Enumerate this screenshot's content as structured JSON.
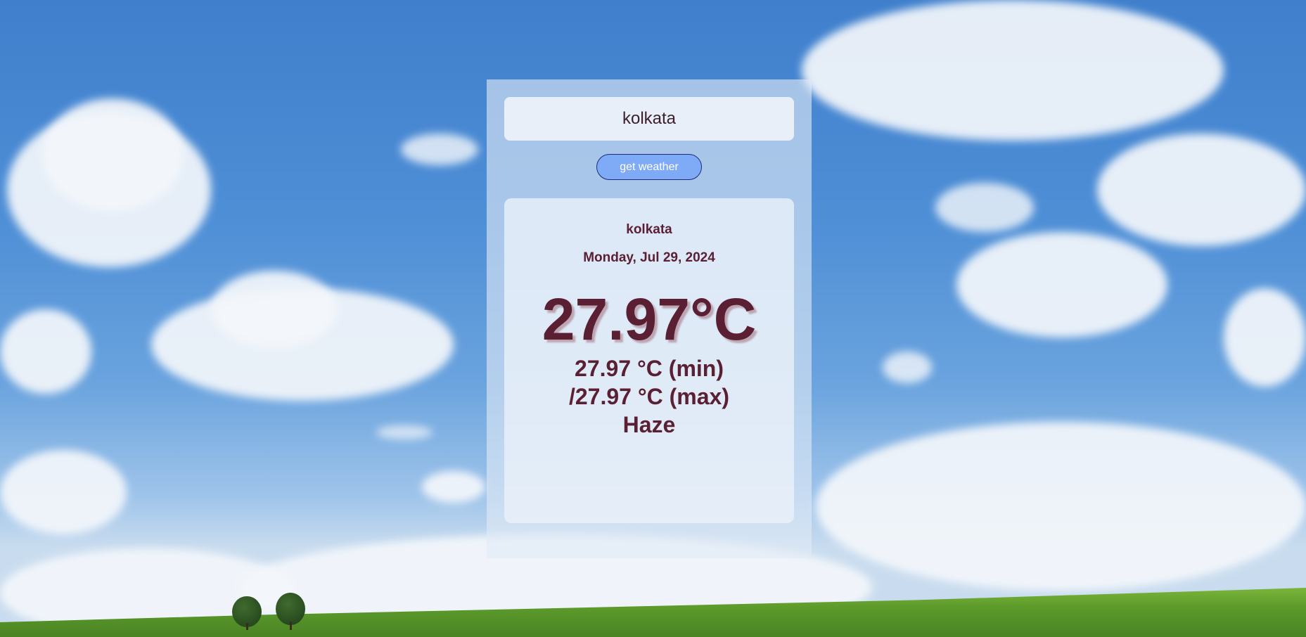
{
  "search": {
    "value": "kolkata",
    "placeholder": ""
  },
  "button": {
    "label": "get weather"
  },
  "weather": {
    "city": "kolkata",
    "date": "Monday, Jul 29, 2024",
    "temperature": "27.97°C",
    "min_line": "27.97 °C (min)",
    "max_line": "/27.97 °C (max)",
    "condition": "Haze"
  },
  "colors": {
    "text": "#5a1f33",
    "button_bg": "#7faaf6",
    "button_border": "#1f2b7a"
  }
}
